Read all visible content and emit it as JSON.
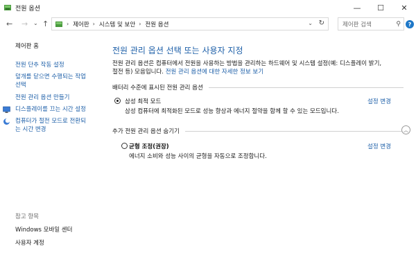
{
  "window": {
    "title": "전원 옵션",
    "minimize": "—",
    "maximize": "☐",
    "close": "✕"
  },
  "nav": {
    "back": "←",
    "forward": "→",
    "recent": "⌄",
    "up": "↑",
    "breadcrumb": [
      "제어판",
      "시스템 및 보안",
      "전원 옵션"
    ],
    "search_placeholder": "제어판 검색"
  },
  "sidebar": {
    "home": "제어판 홈",
    "items": [
      "전원 단추 작동 설정",
      "덮개를 닫으면 수행되는 작업",
      "선택",
      "전원 관리 옵션 만들기",
      "디스플레이를 끄는 시간 설정",
      "컴퓨터가 절전 모드로 전환되",
      "는 시간 변경"
    ],
    "see_also_title": "참고 항목",
    "see_also": [
      "Windows 모바일 센터",
      "사용자 계정"
    ]
  },
  "main": {
    "heading": "전원 관리 옵션 선택 또는 사용자 지정",
    "description_line1": "전원 관리 옵션은 컴퓨터에서 전원을 사용하는 방법을 관리하는 하드웨어 및 시스템 설정(예: 디스플레이 밝기,",
    "description_line2": "절전 등) 모음입니다.",
    "description_link": "전원 관리 옵션에 대한 자세한 정보 보기",
    "section_battery": "배터리 수준에 표시된 전원 관리 옵션",
    "plan1_name": "삼성 최적 모드",
    "plan1_desc": "삼성 컴퓨터에 최적화된 모드로 성능 향상과 에너지 절약을 함께 할 수 있는 모드입니다.",
    "change_settings": "설정 변경",
    "section_hidden": "추가 전원 관리 옵션 숨기기",
    "plan2_name": "균형 조정(권장)",
    "plan2_desc": "에너지 소비와 성능 사이의 균형을 자동으로 조정합니다."
  }
}
